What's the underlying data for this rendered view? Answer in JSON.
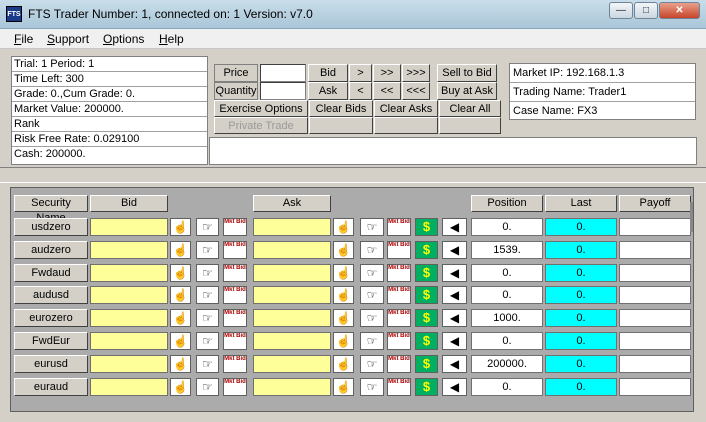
{
  "window": {
    "title": "FTS Trader Number: 1, connected on: 1 Version: v7.0",
    "icon_text": "FTS"
  },
  "window_controls": {
    "minimize": "—",
    "maximize": "□",
    "close": "✕"
  },
  "menu": [
    "File",
    "Support",
    "Options",
    "Help"
  ],
  "status_left": [
    "Trial: 1 Period: 1",
    "Time Left: 300",
    "Grade: 0.,Cum Grade: 0.",
    "Market Value: 200000.",
    "Rank",
    "Risk Free Rate: 0.029100",
    "Cash: 200000."
  ],
  "controls": {
    "price_label": "Price",
    "quantity_label": "Quantity",
    "price_value": "",
    "quantity_value": "",
    "bid": "Bid",
    "ask": "Ask",
    "r1": ">",
    "r2": ">>",
    "r3": ">>>",
    "l1": "<",
    "l2": "<<",
    "l3": "<<<",
    "sell_to_bid": "Sell to Bid",
    "buy_at_ask": "Buy at Ask",
    "exercise_options": "Exercise Options",
    "clear_bids": "Clear Bids",
    "clear_asks": "Clear Asks",
    "clear_all": "Clear All",
    "private_trade": "Private Trade"
  },
  "status_right": [
    "Market IP: 192.168.1.3",
    "Trading Name: Trader1",
    "Case Name: FX3"
  ],
  "table": {
    "headers": {
      "name": "Security Name",
      "bid": "Bid",
      "ask": "Ask",
      "position": "Position",
      "last": "Last",
      "payoff": "Payoff"
    },
    "rows": [
      {
        "name": "usdzero",
        "position": "0.",
        "last": "0."
      },
      {
        "name": "audzero",
        "position": "1539.",
        "last": "0."
      },
      {
        "name": "Fwdaud",
        "position": "0.",
        "last": "0."
      },
      {
        "name": "audusd",
        "position": "0.",
        "last": "0."
      },
      {
        "name": "eurozero",
        "position": "1000.",
        "last": "0."
      },
      {
        "name": "FwdEur",
        "position": "0.",
        "last": "0."
      },
      {
        "name": "eurusd",
        "position": "200000.",
        "last": "0."
      },
      {
        "name": "euraud",
        "position": "0.",
        "last": "0."
      }
    ]
  },
  "icons": {
    "hand": "☝",
    "point": "☞",
    "mb": "Mkt Bid",
    "dollar": "$",
    "tri": "◀"
  }
}
